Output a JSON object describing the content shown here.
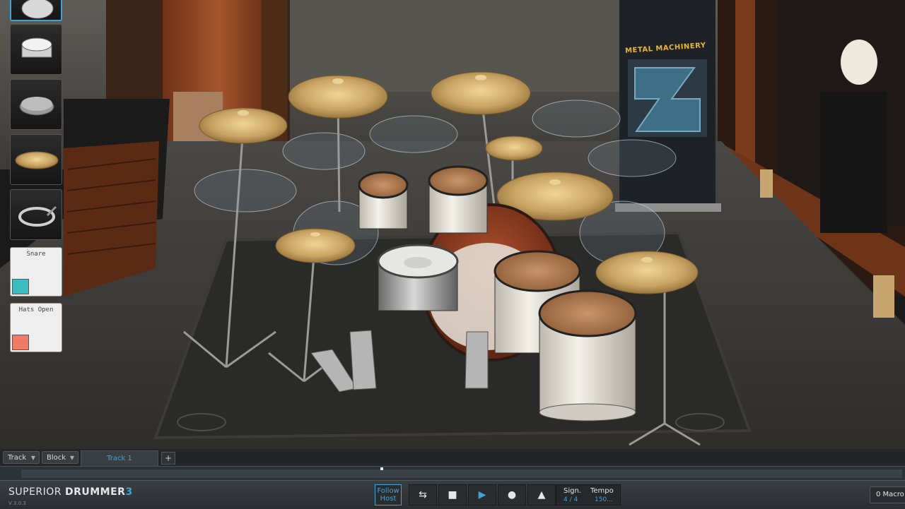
{
  "app": {
    "logo_primary": "SUPERIOR",
    "logo_secondary": "DRUMMER",
    "logo_version_digit": "3",
    "version": "V 3.0.3"
  },
  "instrument_panel": {
    "selected_index": 0,
    "thumbnails": [
      {
        "name": "bass-drum-icon"
      },
      {
        "name": "snare-drum-icon"
      },
      {
        "name": "practice-pad-icon"
      },
      {
        "name": "cymbal-icon"
      },
      {
        "name": "tambourine-icon"
      }
    ],
    "pads": [
      {
        "label": "Snare",
        "color": "#3bbcc0"
      },
      {
        "label": "Hats Open",
        "color": "#f07a64"
      }
    ]
  },
  "banner": {
    "title": "METAL MACHINERY"
  },
  "tabs": {
    "track_button": "Track",
    "block_button": "Block",
    "active_tab": "Track 1",
    "add_label": "+"
  },
  "transport": {
    "follow_host_line1": "Follow",
    "follow_host_line2": "Host",
    "signature_label": "Sign.",
    "signature_value": "4 / 4",
    "tempo_label": "Tempo",
    "tempo_value": "150...",
    "macro_label": "0  Macro"
  },
  "colors": {
    "accent": "#3da3d6",
    "shell_white": "#e9e6dc",
    "drumhead": "#b07a4a",
    "cymbal": "#c9a464",
    "bass_drum": "#8a3a22"
  }
}
